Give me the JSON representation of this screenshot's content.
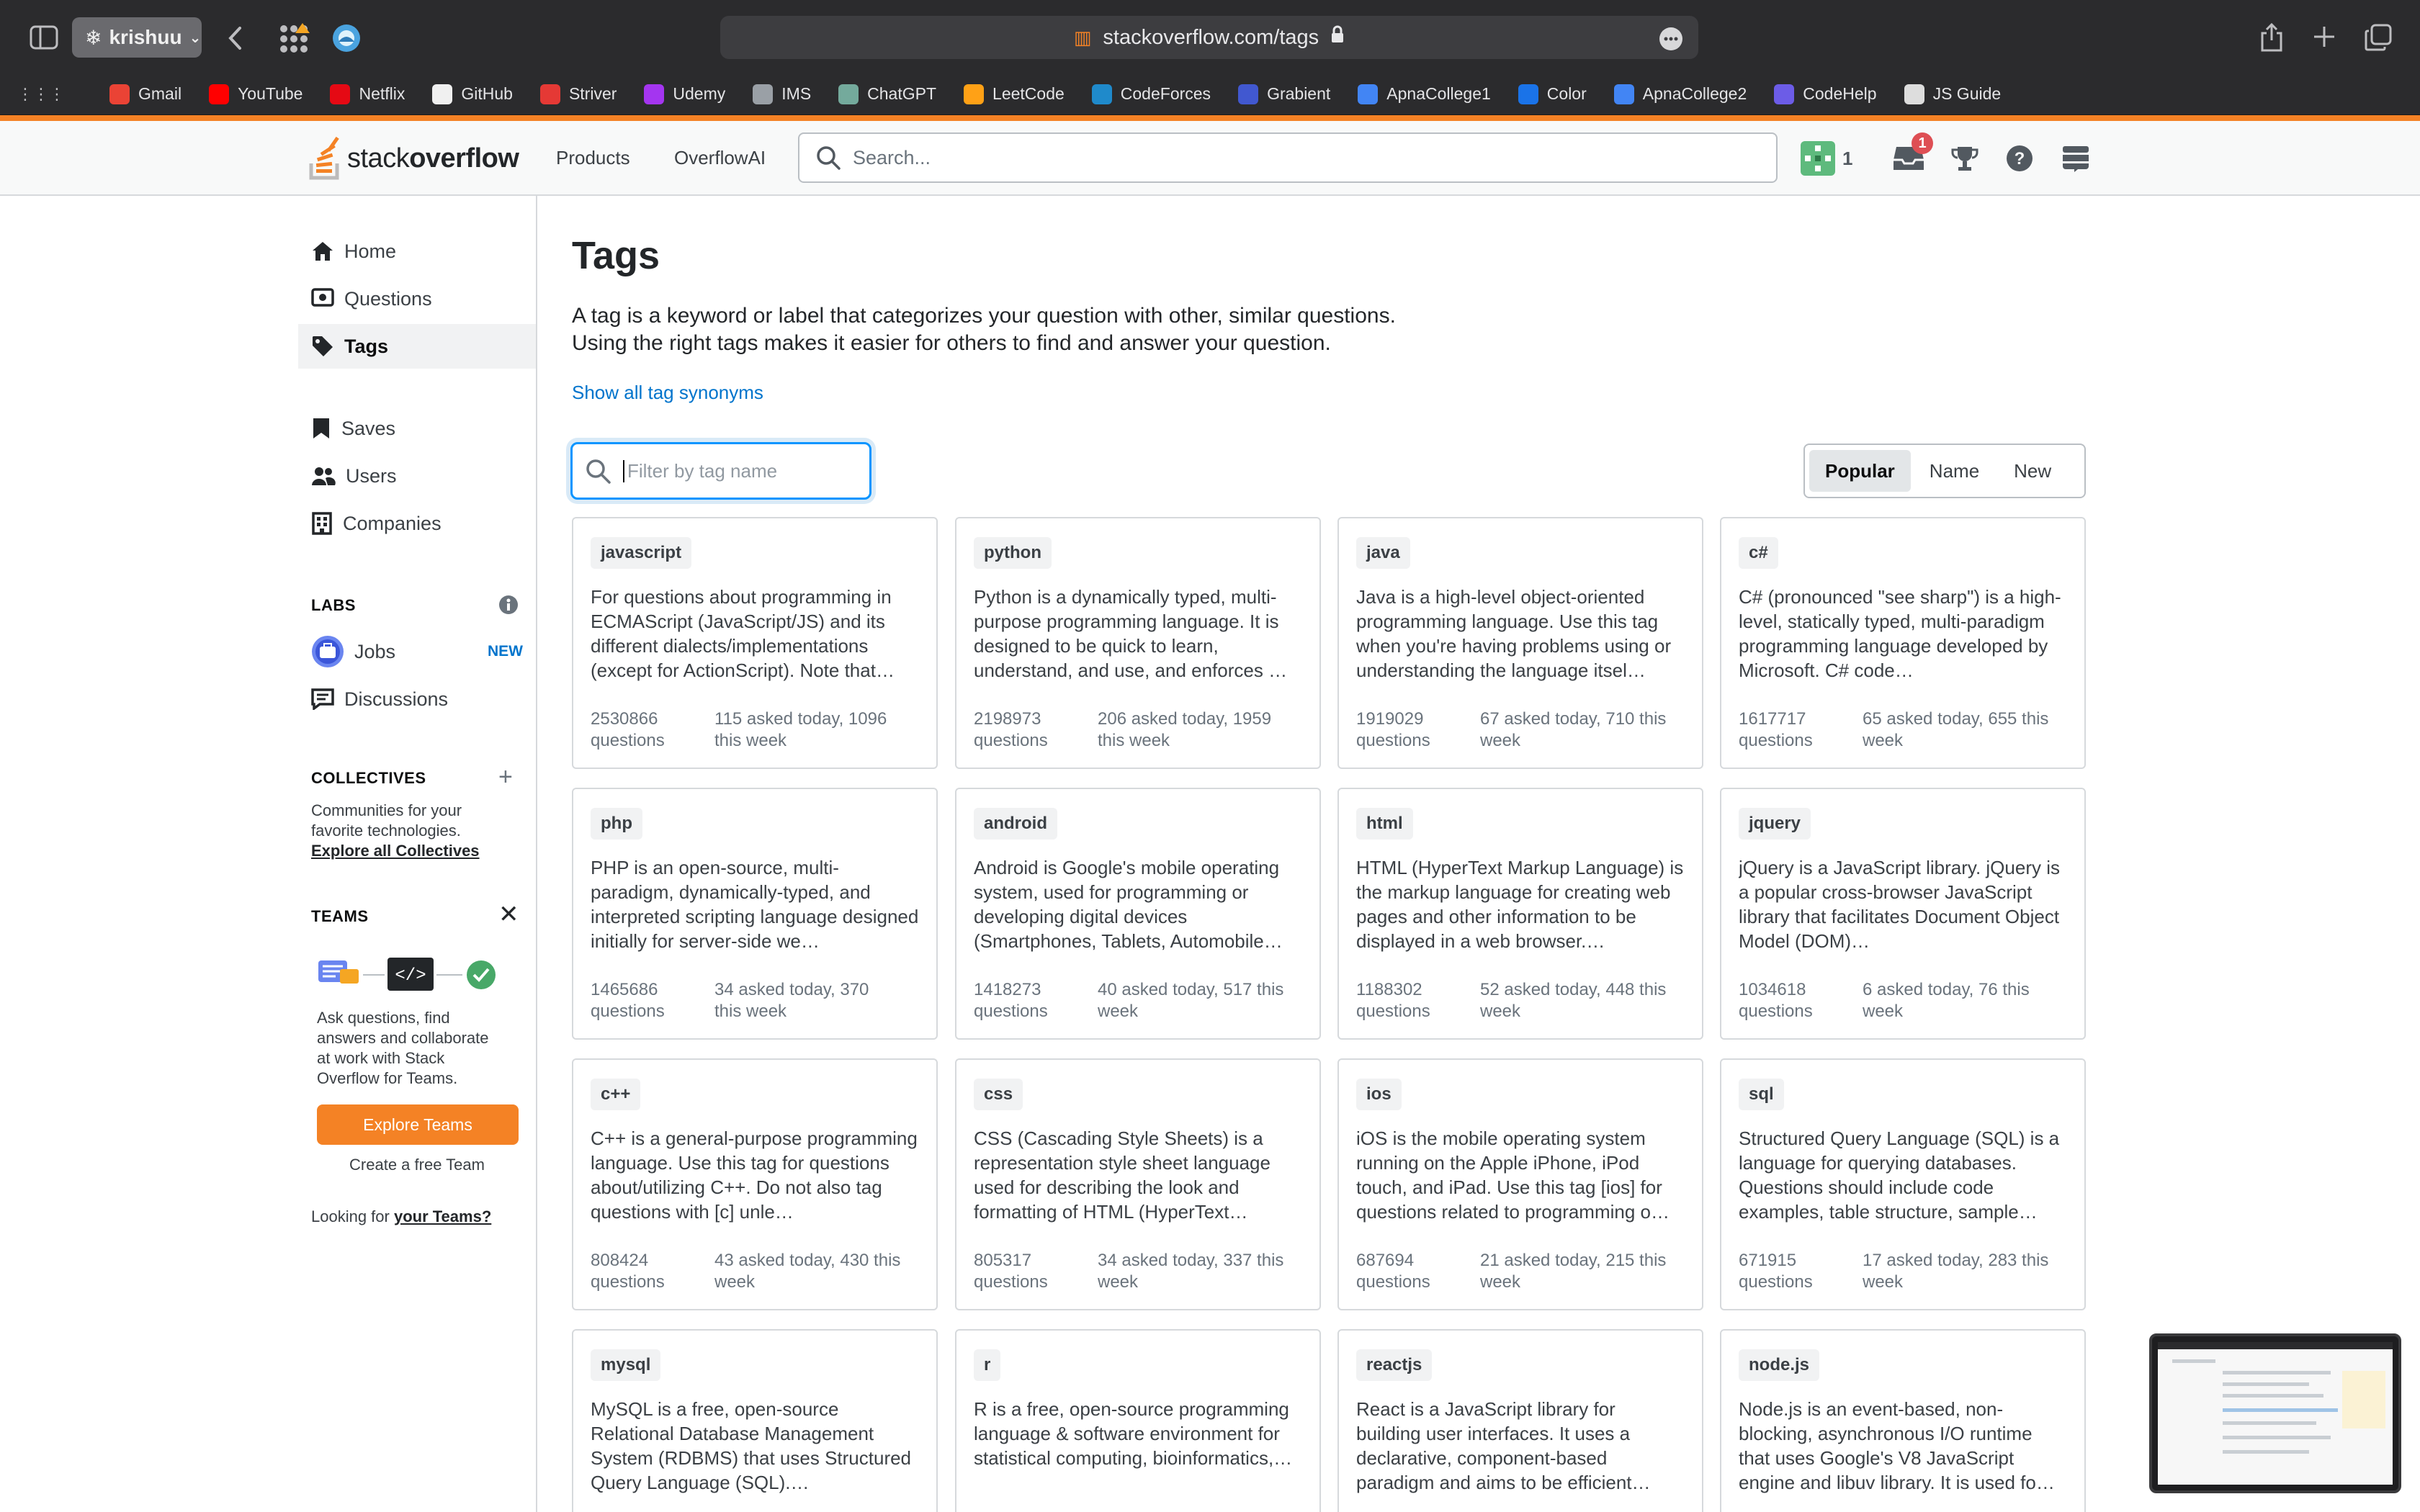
{
  "browser": {
    "profile_name": "krishuu",
    "url": "stackoverflow.com/tags",
    "bookmarks": [
      {
        "label": "Gmail",
        "color": "#ea4335"
      },
      {
        "label": "YouTube",
        "color": "#ff0000"
      },
      {
        "label": "Netflix",
        "color": "#e50914"
      },
      {
        "label": "GitHub",
        "color": "#f0f0f0"
      },
      {
        "label": "Striver",
        "color": "#e53935"
      },
      {
        "label": "Udemy",
        "color": "#a435f0"
      },
      {
        "label": "IMS",
        "color": "#9aa0a6"
      },
      {
        "label": "ChatGPT",
        "color": "#74aa9c"
      },
      {
        "label": "LeetCode",
        "color": "#ffa116"
      },
      {
        "label": "CodeForces",
        "color": "#1f8acb"
      },
      {
        "label": "Grabient",
        "color": "#4158d0"
      },
      {
        "label": "ApnaCollege1",
        "color": "#4285f4"
      },
      {
        "label": "Color",
        "color": "#1a73e8"
      },
      {
        "label": "ApnaCollege2",
        "color": "#4285f4"
      },
      {
        "label": "CodeHelp",
        "color": "#6c5ce7"
      },
      {
        "label": "JS Guide",
        "color": "#dddddd"
      }
    ]
  },
  "header": {
    "logo_text_light": "stack",
    "logo_text_bold": "overflow",
    "nav_products": "Products",
    "nav_overflowai": "OverflowAI",
    "search_placeholder": "Search...",
    "reputation": "1",
    "inbox_count": "1"
  },
  "sidebar": {
    "home": "Home",
    "questions": "Questions",
    "tags": "Tags",
    "saves": "Saves",
    "users": "Users",
    "companies": "Companies",
    "labs_heading": "LABS",
    "jobs": "Jobs",
    "jobs_badge": "NEW",
    "discussions": "Discussions",
    "collectives_heading": "COLLECTIVES",
    "collectives_text_1": "Communities for your",
    "collectives_text_2": "favorite technologies.",
    "collectives_link": "Explore all Collectives",
    "teams_heading": "TEAMS",
    "teams_text": [
      "Ask questions, find",
      "answers and collaborate",
      "at work with Stack",
      "Overflow for Teams."
    ],
    "teams_button": "Explore Teams",
    "teams_free": "Create a free Team",
    "looking_for": "Looking for ",
    "looking_link": "your Teams?"
  },
  "main": {
    "title": "Tags",
    "intro_1": "A tag is a keyword or label that categorizes your question with other, similar questions.",
    "intro_2": "Using the right tags makes it easier for others to find and answer your question.",
    "synonyms_link": "Show all tag synonyms",
    "filter_placeholder": "Filter by tag name",
    "sort_popular": "Popular",
    "sort_name": "Name",
    "sort_new": "New"
  },
  "tags": [
    {
      "name": "javascript",
      "desc": "For questions about programming in ECMAScript (JavaScript/JS) and its different dialects/implementations (except for ActionScript). Note that…",
      "count": "2530866",
      "count_label": "questions",
      "activity_1": "115 asked today, 1096",
      "activity_2": "this week"
    },
    {
      "name": "python",
      "desc": "Python is a dynamically typed, multi-purpose programming language. It is designed to be quick to learn, understand, and use, and enforces …",
      "count": "2198973",
      "count_label": "questions",
      "activity_1": "206 asked today, 1959",
      "activity_2": "this week"
    },
    {
      "name": "java",
      "desc": "Java is a high-level object-oriented programming language. Use this tag when you're having problems using or understanding the language itsel…",
      "count": "1919029",
      "count_label": "questions",
      "activity_1": "67 asked today, 710 this",
      "activity_2": "week"
    },
    {
      "name": "c#",
      "desc": "C# (pronounced \"see sharp\") is a high-level, statically typed, multi-paradigm programming language developed by Microsoft. C# code…",
      "count": "1617717",
      "count_label": "questions",
      "activity_1": "65 asked today, 655 this",
      "activity_2": "week"
    },
    {
      "name": "php",
      "desc": "PHP is an open-source, multi-paradigm, dynamically-typed, and interpreted scripting language designed initially for server-side we…",
      "count": "1465686",
      "count_label": "questions",
      "activity_1": "34 asked today, 370",
      "activity_2": "this week"
    },
    {
      "name": "android",
      "desc": "Android is Google's mobile operating system, used for programming or developing digital devices (Smartphones, Tablets, Automobile…",
      "count": "1418273",
      "count_label": "questions",
      "activity_1": "40 asked today, 517 this",
      "activity_2": "week"
    },
    {
      "name": "html",
      "desc": "HTML (HyperText Markup Language) is the markup language for creating web pages and other information to be displayed in a web browser.…",
      "count": "1188302",
      "count_label": "questions",
      "activity_1": "52 asked today, 448 this",
      "activity_2": "week"
    },
    {
      "name": "jquery",
      "desc": "jQuery is a JavaScript library. jQuery is a popular cross-browser JavaScript library that facilitates Document Object Model (DOM)…",
      "count": "1034618",
      "count_label": "questions",
      "activity_1": "6 asked today, 76 this",
      "activity_2": "week"
    },
    {
      "name": "c++",
      "desc": "C++ is a general-purpose programming language. Use this tag for questions about/utilizing C++. Do not also tag questions with [c] unle…",
      "count": "808424",
      "count_label": "questions",
      "activity_1": "43 asked today, 430 this",
      "activity_2": "week"
    },
    {
      "name": "css",
      "desc": "CSS (Cascading Style Sheets) is a representation style sheet language used for describing the look and formatting of HTML (HyperText…",
      "count": "805317",
      "count_label": "questions",
      "activity_1": "34 asked today, 337 this",
      "activity_2": "week"
    },
    {
      "name": "ios",
      "desc": "iOS is the mobile operating system running on the Apple iPhone, iPod touch, and iPad. Use this tag [ios] for questions related to programming o…",
      "count": "687694",
      "count_label": "questions",
      "activity_1": "21 asked today, 215 this",
      "activity_2": "week"
    },
    {
      "name": "sql",
      "desc": "Structured Query Language (SQL) is a language for querying databases. Questions should include code examples, table structure, sample…",
      "count": "671915",
      "count_label": "questions",
      "activity_1": "17 asked today, 283 this",
      "activity_2": "week"
    },
    {
      "name": "mysql",
      "desc": "MySQL is a free, open-source Relational Database Management System (RDBMS) that uses Structured Query Language (SQL).…",
      "count": "",
      "count_label": "",
      "activity_1": "",
      "activity_2": ""
    },
    {
      "name": "r",
      "desc": "R is a free, open-source programming language & software environment for statistical computing, bioinformatics,…",
      "count": "",
      "count_label": "",
      "activity_1": "",
      "activity_2": ""
    },
    {
      "name": "reactjs",
      "desc": "React is a JavaScript library for building user interfaces. It uses a declarative, component-based paradigm and aims to be efficient…",
      "count": "",
      "count_label": "",
      "activity_1": "",
      "activity_2": ""
    },
    {
      "name": "node.js",
      "desc": "Node.js is an event-based, non-blocking, asynchronous I/O runtime that uses Google's V8 JavaScript engine and libuv library. It is used fo…",
      "count": "",
      "count_label": "",
      "activity_1": "",
      "activity_2": ""
    }
  ],
  "colors": {
    "accent_orange": "#f48225",
    "link_blue": "#0074cc",
    "focus_blue": "#0a95ff",
    "inbox_red": "#de4f54"
  }
}
